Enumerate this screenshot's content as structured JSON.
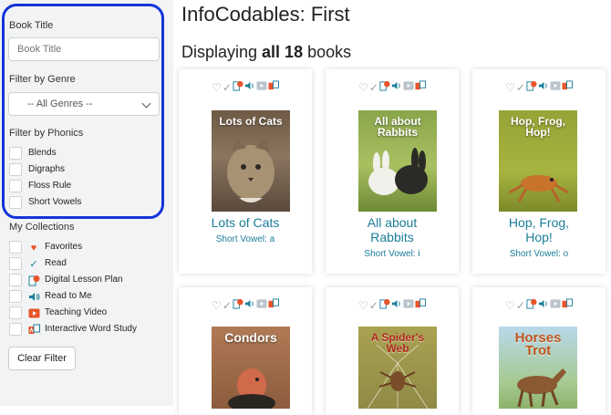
{
  "sidebar": {
    "book_title_label": "Book Title",
    "book_title_placeholder": "Book Title",
    "genre_label": "Filter by Genre",
    "genre_selected": "-- All Genres --",
    "phonics_label": "Filter by Phonics",
    "phonics": [
      "Blends",
      "Digraphs",
      "Floss Rule",
      "Short Vowels"
    ],
    "collections_label": "My Collections",
    "collections": [
      {
        "label": "Favorites",
        "icon": "heart-icon"
      },
      {
        "label": "Read",
        "icon": "check-icon"
      },
      {
        "label": "Digital Lesson Plan",
        "icon": "lesson-plan-icon"
      },
      {
        "label": "Read to Me",
        "icon": "speaker-icon"
      },
      {
        "label": "Teaching Video",
        "icon": "video-icon"
      },
      {
        "label": "Interactive Word Study",
        "icon": "word-study-icon"
      }
    ],
    "clear_label": "Clear Filter"
  },
  "main": {
    "title": "InfoCodables: First",
    "display_prefix": "Displaying ",
    "display_bold": "all 18",
    "display_suffix": " books",
    "books": [
      {
        "cover_title": "Lots of Cats",
        "title": "Lots of Cats",
        "subtitle": "Short Vowel: a"
      },
      {
        "cover_title": "All about Rabbits",
        "title": "All about Rabbits",
        "subtitle": "Short Vowel: i"
      },
      {
        "cover_title": "Hop, Frog, Hop!",
        "title": "Hop, Frog, Hop!",
        "subtitle": "Short Vowel: o"
      },
      {
        "cover_title": "Condors",
        "title": "",
        "subtitle": ""
      },
      {
        "cover_title": "A Spider's Web",
        "title": "",
        "subtitle": ""
      },
      {
        "cover_title": "Horses Trot",
        "title": "",
        "subtitle": ""
      }
    ]
  },
  "colors": {
    "focus_ring": "#1335d9",
    "link": "#1a7d98",
    "heart": "#e8552b",
    "check": "#1a7d98"
  }
}
